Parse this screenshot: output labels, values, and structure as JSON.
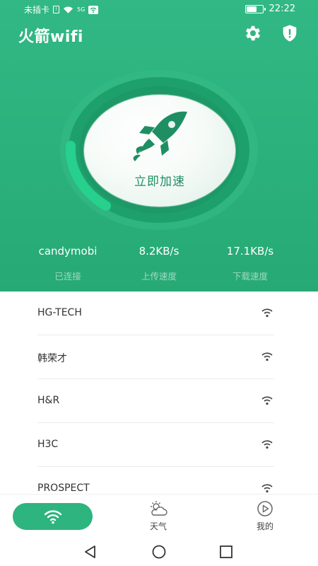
{
  "status_bar": {
    "carrier": "未插卡",
    "network": "5G",
    "time": "22:22"
  },
  "header": {
    "title": "火箭wifi",
    "settings_icon": "gear-icon",
    "security_icon": "shield-alert-icon"
  },
  "boost": {
    "label": "立即加速",
    "icon": "rocket-icon"
  },
  "stats": [
    {
      "value": "candymobi",
      "label": "已连接"
    },
    {
      "value": "8.2KB/s",
      "label": "上传速度"
    },
    {
      "value": "17.1KB/s",
      "label": "下载速度"
    }
  ],
  "wifi_list": [
    {
      "name": "HG-TECH"
    },
    {
      "name": "韩荣才"
    },
    {
      "name": "H&R"
    },
    {
      "name": "H3C"
    },
    {
      "name": "PROSPECT"
    }
  ],
  "bottom_nav": {
    "active_icon": "wifi-icon",
    "tabs": [
      {
        "label": "天气",
        "icon": "weather-cloud-sun-icon"
      },
      {
        "label": "我的",
        "icon": "play-circle-icon"
      }
    ]
  },
  "colors": {
    "primary": "#2db47f",
    "hero_bg": "#2ab07b",
    "boost_text": "#1f8f63"
  }
}
